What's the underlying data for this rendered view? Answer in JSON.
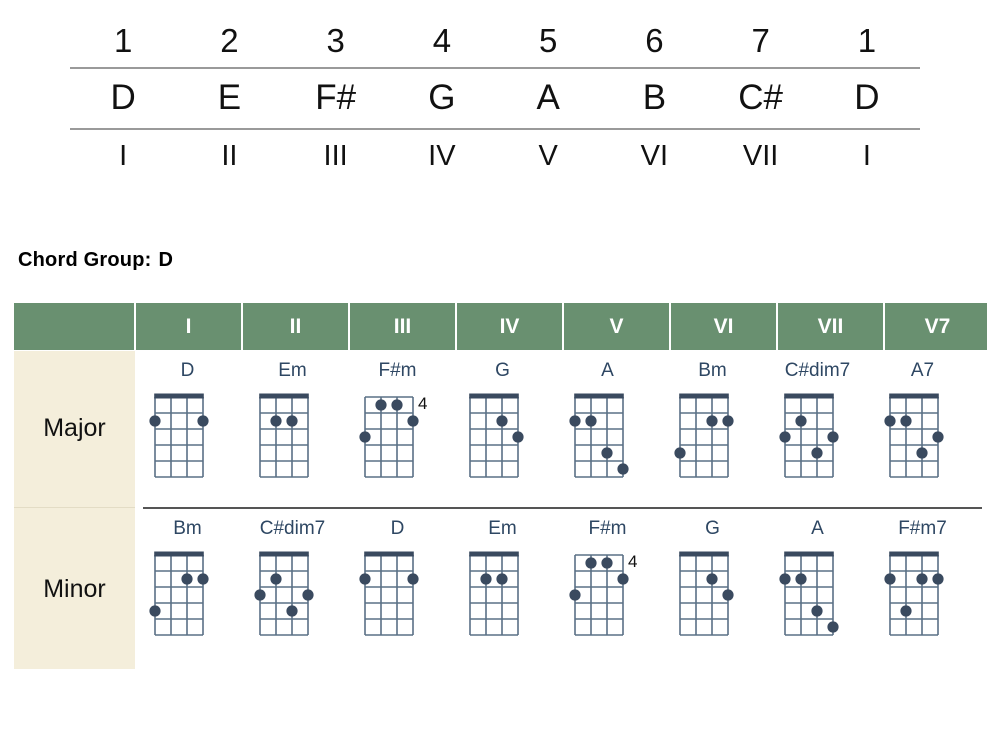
{
  "scale": {
    "degrees": [
      "1",
      "2",
      "3",
      "4",
      "5",
      "6",
      "7",
      "1"
    ],
    "notes": [
      "D",
      "E",
      "F#",
      "G",
      "A",
      "B",
      "C#",
      "D"
    ],
    "roman": [
      "I",
      "II",
      "III",
      "IV",
      "V",
      "VI",
      "VII",
      "I"
    ]
  },
  "chord_group": {
    "label": "Chord Group:",
    "value": "D"
  },
  "table": {
    "header": [
      "",
      "I",
      "II",
      "III",
      "IV",
      "V",
      "VI",
      "VII",
      "V7"
    ],
    "row_labels": [
      "Major",
      "Minor"
    ],
    "colors": {
      "header_bg": "#699070",
      "header_text": "#ffffff",
      "label_bg": "#f4eedb",
      "diagram_stroke": "#5a7085",
      "diagram_nut": "#3a4a5f",
      "dot_color": "#3a4a5f",
      "chord_name_text": "#2e4763"
    },
    "rows": [
      {
        "label": "Major",
        "chords": [
          {
            "degree": "I",
            "name": "D",
            "start_fret": null,
            "show_nut": true,
            "dots": [
              {
                "string": 1,
                "fret": 2
              },
              {
                "string": 4,
                "fret": 2
              }
            ]
          },
          {
            "degree": "II",
            "name": "Em",
            "start_fret": null,
            "show_nut": true,
            "dots": [
              {
                "string": 2,
                "fret": 2
              },
              {
                "string": 3,
                "fret": 2
              }
            ]
          },
          {
            "degree": "III",
            "name": "F#m",
            "start_fret": "4",
            "show_nut": false,
            "dots": [
              {
                "string": 2,
                "fret": 1
              },
              {
                "string": 3,
                "fret": 1
              },
              {
                "string": 4,
                "fret": 2
              },
              {
                "string": 1,
                "fret": 3
              }
            ]
          },
          {
            "degree": "IV",
            "name": "G",
            "start_fret": null,
            "show_nut": true,
            "dots": [
              {
                "string": 3,
                "fret": 2
              },
              {
                "string": 4,
                "fret": 3
              }
            ]
          },
          {
            "degree": "V",
            "name": "A",
            "start_fret": null,
            "show_nut": true,
            "dots": [
              {
                "string": 1,
                "fret": 2
              },
              {
                "string": 2,
                "fret": 2
              },
              {
                "string": 3,
                "fret": 4
              },
              {
                "string": 4,
                "fret": 5
              }
            ]
          },
          {
            "degree": "VI",
            "name": "Bm",
            "start_fret": null,
            "show_nut": true,
            "dots": [
              {
                "string": 3,
                "fret": 2
              },
              {
                "string": 4,
                "fret": 2
              },
              {
                "string": 1,
                "fret": 4
              }
            ]
          },
          {
            "degree": "VII",
            "name": "C#dim7",
            "start_fret": null,
            "show_nut": true,
            "dots": [
              {
                "string": 2,
                "fret": 2
              },
              {
                "string": 1,
                "fret": 3
              },
              {
                "string": 4,
                "fret": 3
              },
              {
                "string": 3,
                "fret": 4
              }
            ]
          },
          {
            "degree": "V7",
            "name": "A7",
            "start_fret": null,
            "show_nut": true,
            "dots": [
              {
                "string": 1,
                "fret": 2
              },
              {
                "string": 2,
                "fret": 2
              },
              {
                "string": 4,
                "fret": 3
              },
              {
                "string": 3,
                "fret": 4
              }
            ]
          }
        ]
      },
      {
        "label": "Minor",
        "chords": [
          {
            "degree": "I",
            "name": "Bm",
            "start_fret": null,
            "show_nut": true,
            "dots": [
              {
                "string": 3,
                "fret": 2
              },
              {
                "string": 4,
                "fret": 2
              },
              {
                "string": 1,
                "fret": 4
              }
            ]
          },
          {
            "degree": "II",
            "name": "C#dim7",
            "start_fret": null,
            "show_nut": true,
            "dots": [
              {
                "string": 2,
                "fret": 2
              },
              {
                "string": 1,
                "fret": 3
              },
              {
                "string": 4,
                "fret": 3
              },
              {
                "string": 3,
                "fret": 4
              }
            ]
          },
          {
            "degree": "III",
            "name": "D",
            "start_fret": null,
            "show_nut": true,
            "dots": [
              {
                "string": 1,
                "fret": 2
              },
              {
                "string": 4,
                "fret": 2
              }
            ]
          },
          {
            "degree": "IV",
            "name": "Em",
            "start_fret": null,
            "show_nut": true,
            "dots": [
              {
                "string": 2,
                "fret": 2
              },
              {
                "string": 3,
                "fret": 2
              }
            ]
          },
          {
            "degree": "V",
            "name": "F#m",
            "start_fret": "4",
            "show_nut": false,
            "dots": [
              {
                "string": 2,
                "fret": 1
              },
              {
                "string": 3,
                "fret": 1
              },
              {
                "string": 4,
                "fret": 2
              },
              {
                "string": 1,
                "fret": 3
              }
            ]
          },
          {
            "degree": "VI",
            "name": "G",
            "start_fret": null,
            "show_nut": true,
            "dots": [
              {
                "string": 3,
                "fret": 2
              },
              {
                "string": 4,
                "fret": 3
              }
            ]
          },
          {
            "degree": "VII",
            "name": "A",
            "start_fret": null,
            "show_nut": true,
            "dots": [
              {
                "string": 1,
                "fret": 2
              },
              {
                "string": 2,
                "fret": 2
              },
              {
                "string": 3,
                "fret": 4
              },
              {
                "string": 4,
                "fret": 5
              }
            ]
          },
          {
            "degree": "V7",
            "name": "F#m7",
            "start_fret": null,
            "show_nut": true,
            "dots": [
              {
                "string": 1,
                "fret": 2
              },
              {
                "string": 3,
                "fret": 2
              },
              {
                "string": 4,
                "fret": 2
              },
              {
                "string": 2,
                "fret": 4
              }
            ]
          }
        ]
      }
    ]
  }
}
